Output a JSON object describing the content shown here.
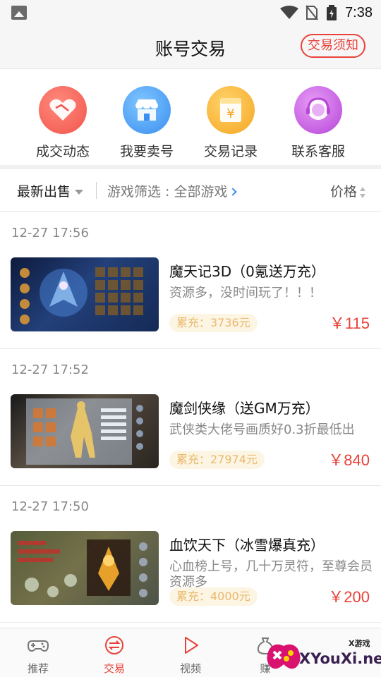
{
  "status_bar": {
    "time": "7:38"
  },
  "header": {
    "title": "账号交易",
    "notice_button": "交易须知"
  },
  "quick_actions": [
    {
      "label": "成交动态",
      "icon": "handshake-icon"
    },
    {
      "label": "我要卖号",
      "icon": "shop-icon"
    },
    {
      "label": "交易记录",
      "icon": "yen-record-icon"
    },
    {
      "label": "联系客服",
      "icon": "customer-service-icon"
    }
  ],
  "filter": {
    "sort_label": "最新出售",
    "game_filter_label": "游戏筛选 : 全部游戏",
    "price_label": "价格"
  },
  "listings": [
    {
      "date": "12-27 17:56",
      "title": "魔天记3D（0氪送万充）",
      "desc": "资源多，没时间玩了！！！",
      "recharge": "累充：3736元",
      "price": "￥115"
    },
    {
      "date": "12-27 17:52",
      "title": "魔剑侠缘（送GM万充）",
      "desc": "武侠类大佬号画质好0.3折最低出",
      "recharge": "累充：27974元",
      "price": "￥840"
    },
    {
      "date": "12-27 17:50",
      "title": "血饮天下（冰雪爆真充）",
      "desc": "心血榜上号，几十万灵符，至尊会员资源多",
      "recharge": "累充：4000元",
      "price": "￥200"
    }
  ],
  "bottom_nav": [
    {
      "label": "推荐",
      "icon": "gamepad-icon",
      "active": false
    },
    {
      "label": "交易",
      "icon": "exchange-icon",
      "active": true
    },
    {
      "label": "视频",
      "icon": "play-icon",
      "active": false
    },
    {
      "label": "赚",
      "icon": "money-bag-icon",
      "active": false
    }
  ],
  "watermark": {
    "brand": "XYouXi.net",
    "small": "X游戏"
  },
  "colors": {
    "accent": "#e8423a",
    "recharge_text": "#e9b96b",
    "recharge_bg": "#fdf5e3"
  }
}
